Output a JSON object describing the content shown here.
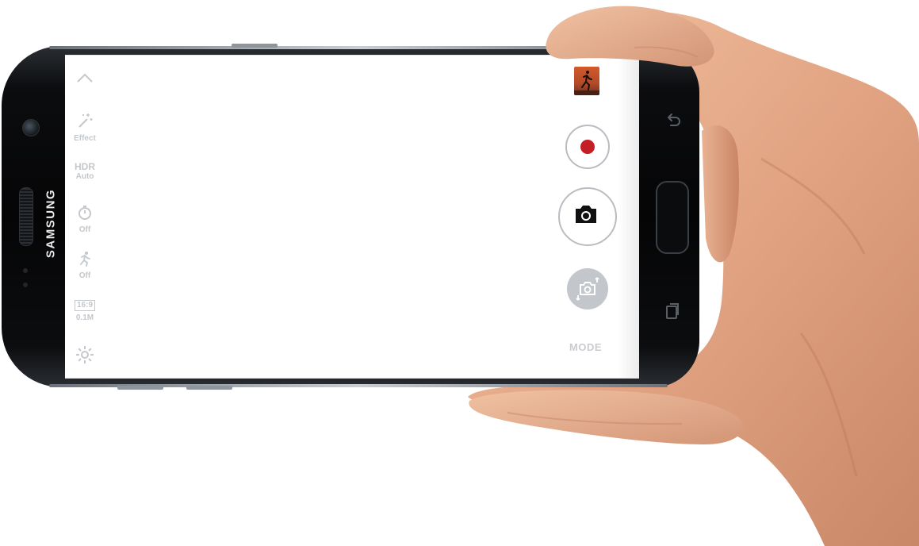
{
  "device": {
    "brand": "SAMSUNG"
  },
  "camera": {
    "sidebar": {
      "effect_label": "Effect",
      "hdr_title": "HDR",
      "hdr_value": "Auto",
      "timer_value": "Off",
      "motion_value": "Off",
      "ratio_title": "16:9",
      "ratio_value": "0.1M"
    },
    "controls": {
      "mode_label": "MODE"
    }
  },
  "icons": {
    "collapse": "chevron-up-icon",
    "effect": "magic-wand-icon",
    "timer": "timer-icon",
    "motion": "running-figure-icon",
    "settings": "gear-icon",
    "record": "record-dot-icon",
    "capture": "camera-icon",
    "switch": "switch-camera-icon",
    "back": "back-arrow-icon",
    "recent": "recent-apps-icon"
  },
  "colors": {
    "record_red": "#c41f24",
    "ui_gray": "#c4c8cc",
    "skin": "#e8b090"
  }
}
